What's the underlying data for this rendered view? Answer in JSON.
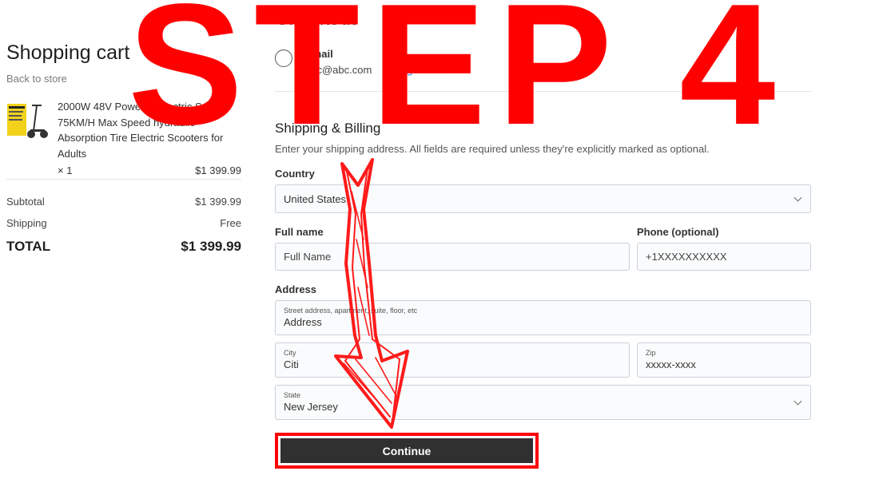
{
  "cart": {
    "title": "Shopping cart",
    "back_link": "Back to store",
    "item": {
      "name": "2000W 48V Powerful Electric Scooter 75KM/H Max Speed hydraulic Absorption Tire Electric Scooters for Adults",
      "qty": "× 1",
      "price": "$1 399.99"
    },
    "subtotal_label": "Subtotal",
    "subtotal_value": "$1 399.99",
    "shipping_label": "Shipping",
    "shipping_value": "Free",
    "total_label": "TOTAL",
    "total_value": "$1 399.99"
  },
  "checkout": {
    "title": "Checkout",
    "email_label": "Email",
    "email_value": "abc@abc.com",
    "change_email": "Change email",
    "shipping_title": "Shipping & Billing",
    "shipping_subtitle": "Enter your shipping address. All fields are required unless they're explicitly marked as optional.",
    "country_label": "Country",
    "country_value": "United States",
    "fullname_label": "Full name",
    "fullname_placeholder": "Full Name",
    "phone_label": "Phone (optional)",
    "phone_placeholder": "+1XXXXXXXXXX",
    "address_label": "Address",
    "street_caption": "Street address, apartment, suite, floor, etc",
    "street_placeholder": "Address",
    "city_caption": "City",
    "city_value": "Citi",
    "zip_caption": "Zip",
    "zip_placeholder": "xxxxx-xxxx",
    "state_caption": "State",
    "state_value": "New Jersey",
    "continue_label": "Continue"
  },
  "overlay": {
    "text": "STEP 4",
    "color": "#ff0000"
  },
  "icons": [
    "product-thumbnail",
    "check-circle-icon",
    "chevron-down-icon",
    "arrow-annotation-icon"
  ]
}
